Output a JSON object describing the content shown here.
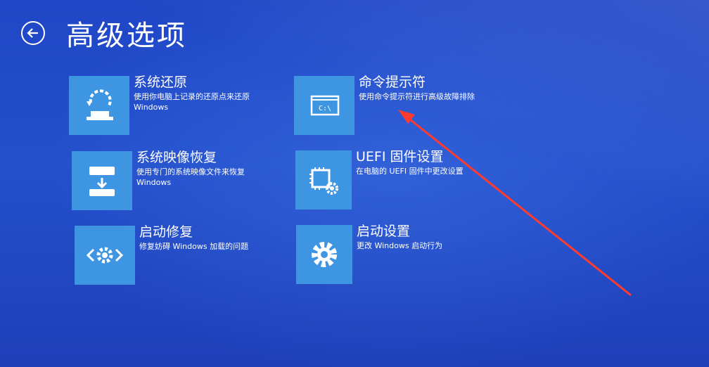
{
  "header": {
    "title": "高级选项",
    "back_icon": "back-arrow-icon"
  },
  "options": [
    {
      "title": "系统还原",
      "desc": "使用你电脑上记录的还原点来还原 Windows",
      "icon": "system-restore-icon"
    },
    {
      "title": "系统映像恢复",
      "desc": "使用专门的系统映像文件来恢复 Windows",
      "icon": "system-image-recovery-icon"
    },
    {
      "title": "启动修复",
      "desc": "修复妨碍 Windows 加载的问题",
      "icon": "startup-repair-icon"
    },
    {
      "title": "命令提示符",
      "desc": "使用命令提示符进行高级故障排除",
      "icon": "command-prompt-icon",
      "icon_text": "C:\\"
    },
    {
      "title": "UEFI 固件设置",
      "desc": "在电脑的 UEFI 固件中更改设置",
      "icon": "uefi-firmware-icon"
    },
    {
      "title": "启动设置",
      "desc": "更改 Windows 启动行为",
      "icon": "startup-settings-icon"
    }
  ],
  "colors": {
    "background": "#2450cc",
    "tile": "#3e96e3",
    "annotation_arrow": "#ff3b30"
  }
}
